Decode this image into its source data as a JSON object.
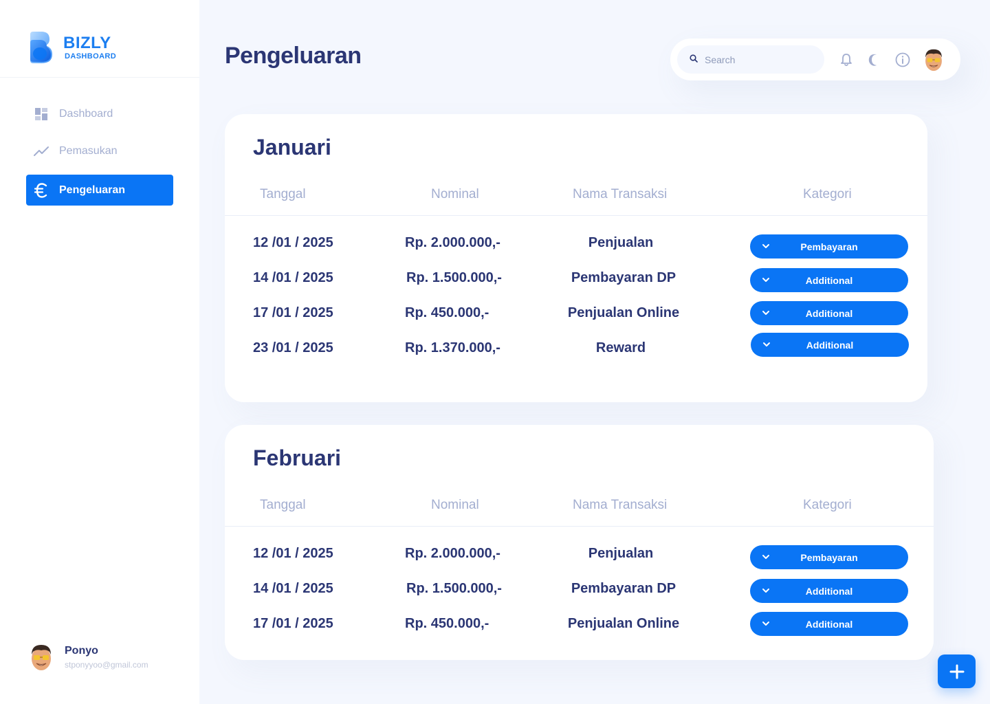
{
  "brand": {
    "name": "BIZLY",
    "subtitle": "DASHBOARD"
  },
  "sidebar": {
    "items": [
      {
        "label": "Dashboard",
        "icon": "grid-icon",
        "active": false
      },
      {
        "label": "Pemasukan",
        "icon": "trend-line-icon",
        "active": false
      },
      {
        "label": "Pengeluaran",
        "icon": "euro-icon",
        "active": true
      }
    ]
  },
  "profile": {
    "name": "Ponyo",
    "email": "stponyyoo@gmail.com"
  },
  "header": {
    "title": "Pengeluaran",
    "search_placeholder": "Search",
    "icons": [
      "search-icon",
      "bell-icon",
      "moon-icon",
      "info-icon"
    ]
  },
  "tables": [
    {
      "month": "Januari",
      "columns": [
        "Tanggal",
        "Nominal",
        "Nama Transaksi",
        "Kategori"
      ],
      "rows": [
        {
          "date": "12 /01 / 2025",
          "nominal": "Rp. 2.000.000,-",
          "name": "Penjualan",
          "category": "Pembayaran"
        },
        {
          "date": "14 /01 / 2025",
          "nominal": "Rp. 1.500.000,-",
          "name": "Pembayaran DP",
          "category": "Additional"
        },
        {
          "date": "17 /01 / 2025",
          "nominal": "Rp. 450.000,-",
          "name": "Penjualan Online",
          "category": "Additional"
        },
        {
          "date": "23 /01 / 2025",
          "nominal": "Rp. 1.370.000,-",
          "name": "Reward",
          "category": "Additional"
        }
      ]
    },
    {
      "month": "Februari",
      "columns": [
        "Tanggal",
        "Nominal",
        "Nama Transaksi",
        "Kategori"
      ],
      "rows": [
        {
          "date": "12 /01 / 2025",
          "nominal": "Rp. 2.000.000,-",
          "name": "Penjualan",
          "category": "Pembayaran"
        },
        {
          "date": "14 /01 / 2025",
          "nominal": "Rp. 1.500.000,-",
          "name": "Pembayaran DP",
          "category": "Additional"
        },
        {
          "date": "17 /01 / 2025",
          "nominal": "Rp. 450.000,-",
          "name": "Penjualan Online",
          "category": "Additional"
        }
      ]
    }
  ],
  "fab": {
    "icon": "plus-icon"
  },
  "colors": {
    "accent": "#0a75f5",
    "text": "#2b3674",
    "muted": "#a3aed0",
    "background": "#f4f7fe"
  }
}
